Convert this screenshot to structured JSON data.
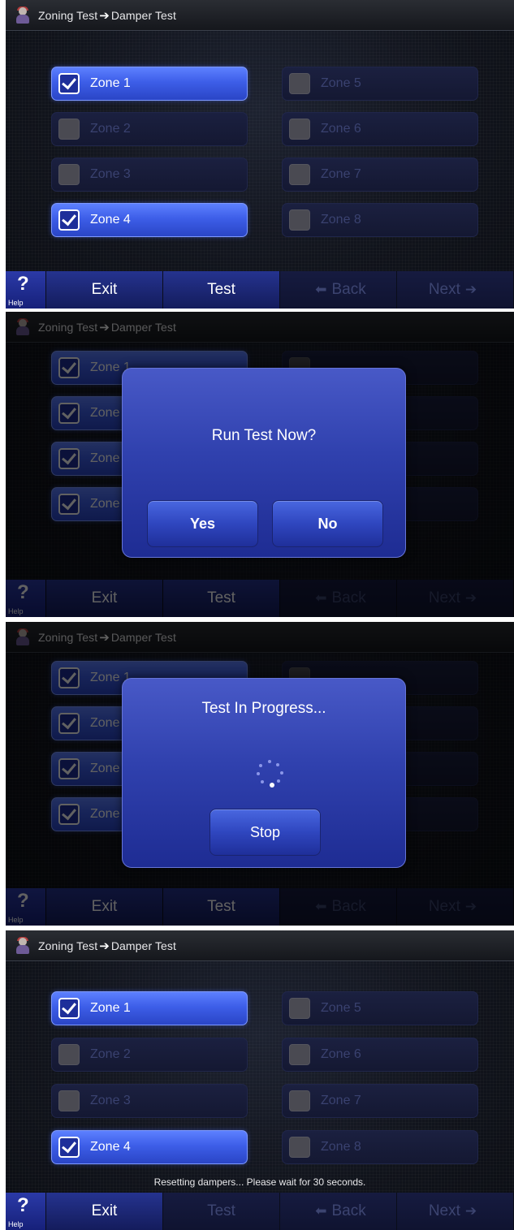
{
  "header": {
    "crumb_from": "Zoning Test",
    "crumb_arrow_icon": "right-arrow-icon",
    "crumb_to": "Damper Test"
  },
  "zones": [
    {
      "label": "Zone 1",
      "checked": true
    },
    {
      "label": "Zone 2",
      "checked": false
    },
    {
      "label": "Zone 3",
      "checked": false
    },
    {
      "label": "Zone 4",
      "checked": true
    },
    {
      "label": "Zone 5",
      "checked": false
    },
    {
      "label": "Zone 6",
      "checked": false
    },
    {
      "label": "Zone 7",
      "checked": false
    },
    {
      "label": "Zone 8",
      "checked": false
    }
  ],
  "bottom_bar": {
    "help_glyph": "?",
    "help_label": "Help",
    "exit_label": "Exit",
    "test_label": "Test",
    "back_label": "Back",
    "next_label": "Next"
  },
  "confirm_dialog": {
    "title": "Run Test Now?",
    "yes_label": "Yes",
    "no_label": "No"
  },
  "progress_dialog": {
    "title": "Test In Progress...",
    "stop_label": "Stop"
  },
  "status": {
    "message": "Resetting dampers... Please wait for 30 seconds."
  },
  "colors": {
    "accent": "#3d5ee8",
    "dialog": "#3041ae",
    "background": "#10131b"
  }
}
